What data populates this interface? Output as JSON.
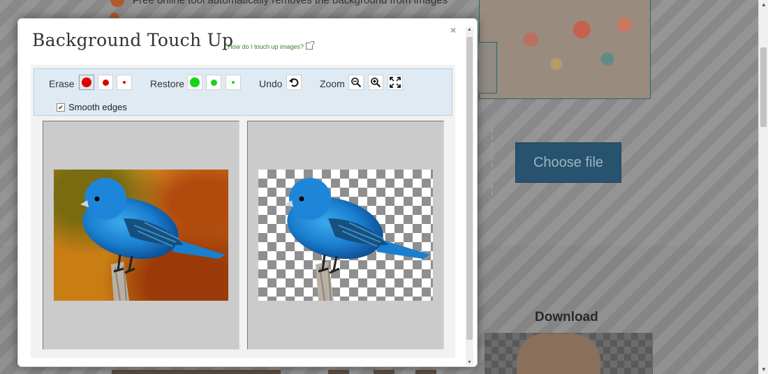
{
  "background_page": {
    "tagline": "Free online tool automatically removes the background from images",
    "choose_file_label": "Choose file",
    "download_heading": "Download"
  },
  "dialog": {
    "title": "Background Touch Up",
    "help_link": "How do I touch up images?",
    "close_label": "×"
  },
  "toolbar": {
    "erase_label": "Erase",
    "restore_label": "Restore",
    "undo_label": "Undo",
    "zoom_label": "Zoom",
    "smooth_edges_label": "Smooth edges",
    "smooth_edges_checked": true,
    "erase_sizes": [
      "large",
      "medium",
      "small"
    ],
    "erase_selected": "large",
    "restore_sizes": [
      "large",
      "medium",
      "small"
    ],
    "icons": {
      "undo": "undo-arrow-icon",
      "zoom_out": "zoom-out-icon",
      "zoom_in": "zoom-in-icon",
      "fit": "fit-to-screen-icon"
    },
    "colors": {
      "erase": "#e00000",
      "restore": "#17d417",
      "toolbar_bg": "#dfeaf2"
    }
  },
  "panels": {
    "left": "original-image",
    "right": "result-image-transparent-background"
  }
}
